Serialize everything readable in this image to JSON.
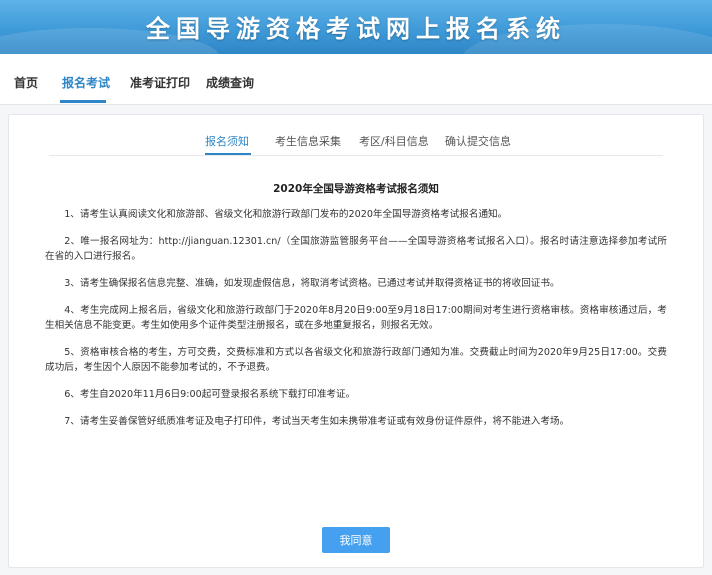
{
  "header": {
    "title": "全国导游资格考试网上报名系统"
  },
  "nav": {
    "items": [
      {
        "label": "首页"
      },
      {
        "label": "报名考试"
      },
      {
        "label": "准考证打印"
      },
      {
        "label": "成绩查询"
      }
    ],
    "active_index": 1
  },
  "tabs": {
    "items": [
      {
        "label": "报名须知"
      },
      {
        "label": "考生信息采集"
      },
      {
        "label": "考区/科目信息"
      },
      {
        "label": "确认提交信息"
      }
    ],
    "active_index": 0
  },
  "notice": {
    "title": "2020年全国导游资格考试报名须知",
    "paragraphs": [
      "1、请考生认真阅读文化和旅游部、省级文化和旅游行政部门发布的2020年全国导游资格考试报名通知。",
      "2、唯一报名网址为：http://jianguan.12301.cn/（全国旅游监管服务平台——全国导游资格考试报名入口）。报名时请注意选择参加考试所在省的入口进行报名。",
      "3、请考生确保报名信息完整、准确，如发现虚假信息，将取消考试资格。已通过考试并取得资格证书的将收回证书。",
      "4、考生完成网上报名后，省级文化和旅游行政部门于2020年8月20日9:00至9月18日17:00期间对考生进行资格审核。资格审核通过后，考生相关信息不能变更。考生如使用多个证件类型注册报名，或在多地重复报名，则报名无效。",
      "5、资格审核合格的考生，方可交费，交费标准和方式以各省级文化和旅游行政部门通知为准。交费截止时间为2020年9月25日17:00。交费成功后，考生因个人原因不能参加考试的，不予退费。",
      "6、考生自2020年11月6日9:00起可登录报名系统下载打印准考证。",
      "7、请考生妥善保管好纸质准考证及电子打印件，考试当天考生如未携带准考证或有效身份证件原件，将不能进入考场。"
    ]
  },
  "actions": {
    "agree_label": "我同意"
  },
  "colors": {
    "accent": "#2f86c6",
    "button": "#46a0f0"
  }
}
